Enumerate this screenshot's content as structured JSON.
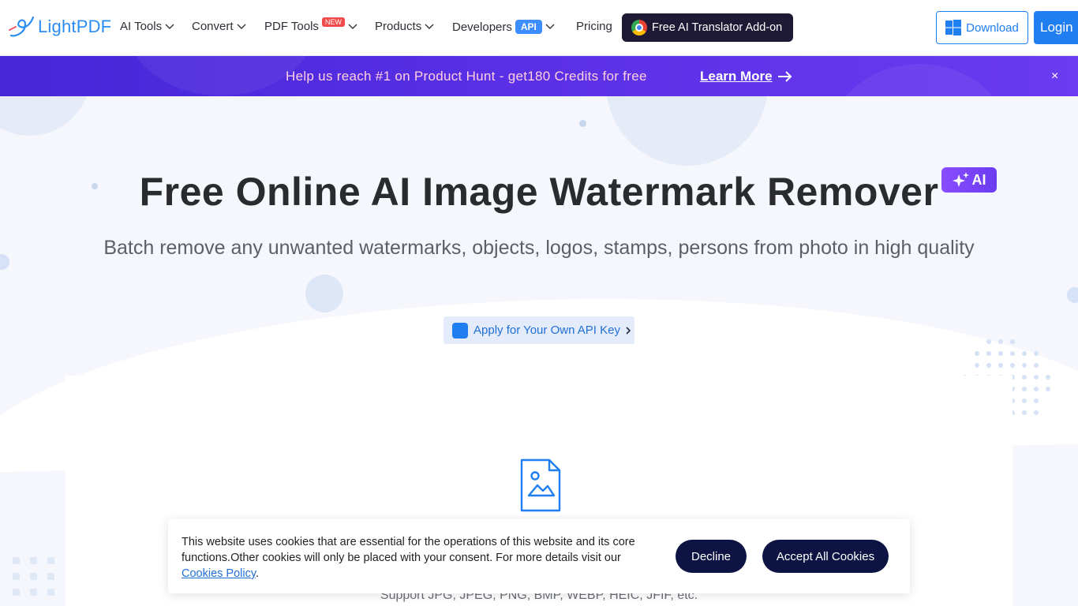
{
  "header": {
    "logo_text": "LightPDF",
    "nav": [
      {
        "label": "AI Tools"
      },
      {
        "label": "Convert"
      },
      {
        "label": "PDF Tools",
        "badge": "NEW"
      },
      {
        "label": "Products"
      },
      {
        "label": "Developers",
        "badge": "API"
      },
      {
        "label": "Pricing"
      }
    ],
    "translator_label": "Free AI Translator Add-on",
    "download_label": "Download",
    "login_label": "Login"
  },
  "promo": {
    "text": "Help us reach #1 on Product Hunt - get180 Credits for free",
    "link": "Learn More",
    "close": "×"
  },
  "hero": {
    "title": "Free Online AI Image Watermark Remover",
    "ai_badge": "AI",
    "subtitle": "Batch remove any unwanted watermarks, objects, logos, stamps, persons from photo in high quality",
    "api_key_label": "Apply for Your Own API Key"
  },
  "upload": {
    "support_text": "Support JPG, JPEG, PNG, BMP, WEBP, HEIC, JFIF, etc."
  },
  "cookie": {
    "text": "This website uses cookies that are essential for the operations of this website and its core functions.Other cookies will only be placed with your consent. For more details visit our",
    "link": "Cookies Policy",
    "period": ".",
    "decline": "Decline",
    "accept": "Accept All Cookies"
  },
  "colors": {
    "brand": "#1f7ef0",
    "promo_bg": "#5a30e6",
    "dark_button": "#0d1444",
    "ai_badge": "#7a44f8"
  }
}
